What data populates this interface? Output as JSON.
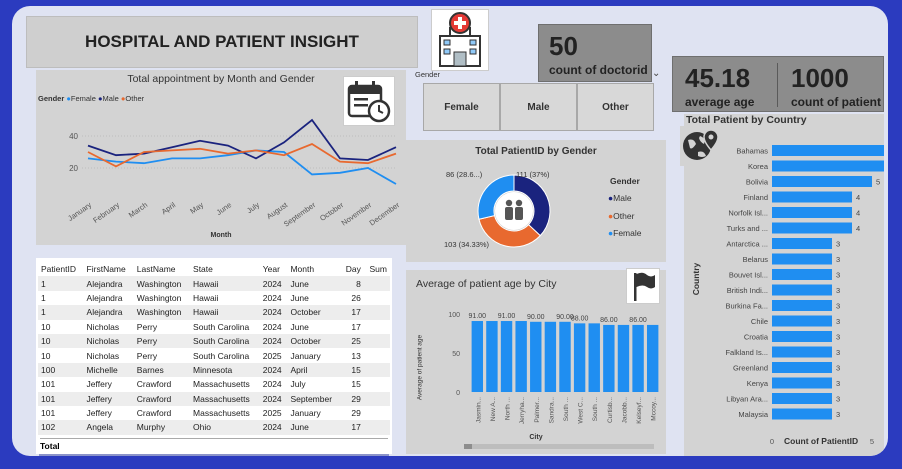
{
  "header": {
    "title": "HOSPITAL AND PATIENT INSIGHT"
  },
  "kpis": {
    "doctors": {
      "value": "50",
      "label": "count of doctorid"
    },
    "age": {
      "value": "45.18",
      "label": "average age"
    },
    "patients": {
      "value": "1000",
      "label": "count of patient"
    }
  },
  "slicer": {
    "title": "Gender",
    "options": [
      "Female",
      "Male",
      "Other"
    ]
  },
  "appointments": {
    "title": "Total appointment by Month and Gender",
    "legend_title": "Gender",
    "xlabel": "Month",
    "colors": {
      "Female": "#1f8ef1",
      "Male": "#1a237e",
      "Other": "#e8692f"
    }
  },
  "donut": {
    "title": "Total PatientID by Gender",
    "legend_title": "Gender",
    "labels": {
      "male": "111 (37%)",
      "other": "103 (34.33%)",
      "female": "86 (28.6...)"
    }
  },
  "agecity": {
    "title": "Average of patient age by City",
    "ylabel": "Average of patient age",
    "xlabel": "City"
  },
  "country": {
    "title": "Total Patient by Country",
    "ylabel": "Country",
    "xlabel": "Count of PatientID"
  },
  "table": {
    "columns": [
      "PatientID",
      "FirstName",
      "LastName",
      "State",
      "Year",
      "Month",
      "Day",
      "Sum"
    ],
    "rows": [
      [
        "1",
        "Alejandra",
        "Washington",
        "Hawaii",
        "2024",
        "June",
        "8"
      ],
      [
        "1",
        "Alejandra",
        "Washington",
        "Hawaii",
        "2024",
        "June",
        "26"
      ],
      [
        "1",
        "Alejandra",
        "Washington",
        "Hawaii",
        "2024",
        "October",
        "17"
      ],
      [
        "10",
        "Nicholas",
        "Perry",
        "South Carolina",
        "2024",
        "June",
        "17"
      ],
      [
        "10",
        "Nicholas",
        "Perry",
        "South Carolina",
        "2024",
        "October",
        "25"
      ],
      [
        "10",
        "Nicholas",
        "Perry",
        "South Carolina",
        "2025",
        "January",
        "13"
      ],
      [
        "100",
        "Michelle",
        "Barnes",
        "Minnesota",
        "2024",
        "April",
        "15"
      ],
      [
        "101",
        "Jeffery",
        "Crawford",
        "Massachusetts",
        "2024",
        "July",
        "15"
      ],
      [
        "101",
        "Jeffery",
        "Crawford",
        "Massachusetts",
        "2024",
        "September",
        "29"
      ],
      [
        "101",
        "Jeffery",
        "Crawford",
        "Massachusetts",
        "2025",
        "January",
        "29"
      ],
      [
        "102",
        "Angela",
        "Murphy",
        "Ohio",
        "2024",
        "June",
        "17"
      ]
    ],
    "total_label": "Total"
  },
  "chart_data": [
    {
      "type": "line",
      "title": "Total appointment by Month and Gender",
      "xlabel": "Month",
      "ylabel": "",
      "x": [
        "January",
        "February",
        "March",
        "April",
        "May",
        "June",
        "July",
        "August",
        "September",
        "October",
        "November",
        "December"
      ],
      "ylim": [
        0,
        60
      ],
      "yticks": [
        20,
        40
      ],
      "series": [
        {
          "name": "Female",
          "values": [
            26,
            24,
            23,
            26,
            26,
            28,
            31,
            30,
            16,
            17,
            20,
            10
          ]
        },
        {
          "name": "Male",
          "values": [
            34,
            28,
            29,
            33,
            37,
            34,
            26,
            36,
            50,
            26,
            25,
            33
          ]
        },
        {
          "name": "Other",
          "values": [
            30,
            21,
            30,
            31,
            32,
            29,
            31,
            28,
            35,
            24,
            23,
            29
          ]
        }
      ],
      "legend": "top-left"
    },
    {
      "type": "pie",
      "title": "Total PatientID by Gender",
      "categories": [
        "Male",
        "Other",
        "Female"
      ],
      "values": [
        111,
        103,
        86
      ],
      "colors": [
        "#1a237e",
        "#e8692f",
        "#1f8ef1"
      ],
      "legend": "right"
    },
    {
      "type": "bar",
      "title": "Average of patient age by City",
      "xlabel": "City",
      "ylabel": "Average of patient age",
      "categories": [
        "Jasmin...",
        "New A...",
        "North ...",
        "Jerryha...",
        "Palmer...",
        "Sandra...",
        "South ...",
        "West C...",
        "South ...",
        "Curtisb...",
        "Jacobb...",
        "Kelseyf...",
        "Mccoy..."
      ],
      "values": [
        91,
        91,
        91,
        91,
        90,
        90,
        90,
        88,
        88,
        86,
        86,
        86,
        86
      ],
      "data_labels": [
        "91.00",
        "",
        "91.00",
        "",
        "90.00",
        "",
        "90.00",
        "88.00",
        "",
        "86.00",
        "",
        "86.00",
        ""
      ],
      "ylim": [
        0,
        100
      ],
      "yticks": [
        0,
        50,
        100
      ]
    },
    {
      "type": "bar",
      "orientation": "horizontal",
      "title": "Total Patient by Country",
      "xlabel": "Count of PatientID",
      "ylabel": "Country",
      "categories": [
        "Bahamas",
        "Korea",
        "Bolivia",
        "Finland",
        "Norfolk Isl...",
        "Turks and ...",
        "Antarctica ...",
        "Belarus",
        "Bouvet Isl...",
        "British Indi...",
        "Burkina Fa...",
        "Chile",
        "Croatia",
        "Falkland Is...",
        "Greenland",
        "Kenya",
        "Libyan Ara...",
        "Malaysia"
      ],
      "values": [
        6,
        6,
        5,
        4,
        4,
        4,
        3,
        3,
        3,
        3,
        3,
        3,
        3,
        3,
        3,
        3,
        3,
        3
      ],
      "xlim": [
        0,
        6
      ],
      "xticks": [
        0,
        5
      ]
    }
  ]
}
